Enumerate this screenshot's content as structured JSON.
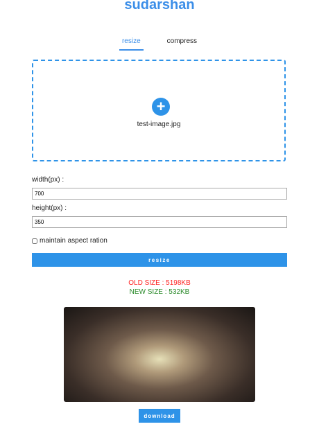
{
  "title": "sudarshan",
  "tabs": [
    {
      "label": "resize"
    },
    {
      "label": "compress"
    }
  ],
  "upload": {
    "file_name": "test-image.jpg"
  },
  "form": {
    "width_label": "width(px) :",
    "width_value": "700",
    "height_label": "height(px) :",
    "height_value": "350",
    "aspect_label": "maintain aspect ration",
    "resize_label": "resize"
  },
  "result": {
    "old_size": "OLD SIZE : 5198KB",
    "new_size": "NEW SIZE : 532KB",
    "download_label": "download"
  }
}
